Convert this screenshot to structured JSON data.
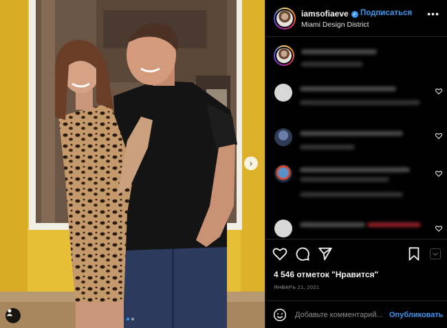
{
  "post": {
    "username": "iamsofiaeve",
    "follow_label": "Подписаться",
    "location": "Miami Design District",
    "more_label": "•••"
  },
  "actions": {
    "like_icon": "heart-icon",
    "comment_icon": "comment-bubble-icon",
    "share_icon": "send-icon",
    "save_icon": "bookmark-icon"
  },
  "likes_text": "4 546 отметок \"Нравится\"",
  "date_text": "ЯНВАРЬ 21, 2021",
  "add_comment": {
    "placeholder": "Добавьте комментарий...",
    "publish_label": "Опубликовать"
  },
  "carousel": {
    "next_label": "›",
    "total_slides": 2,
    "current_slide": 1
  },
  "colors": {
    "accent": "#3897f0",
    "background": "#000000",
    "divider": "#262626",
    "wall_yellow": "#e8c23a"
  }
}
